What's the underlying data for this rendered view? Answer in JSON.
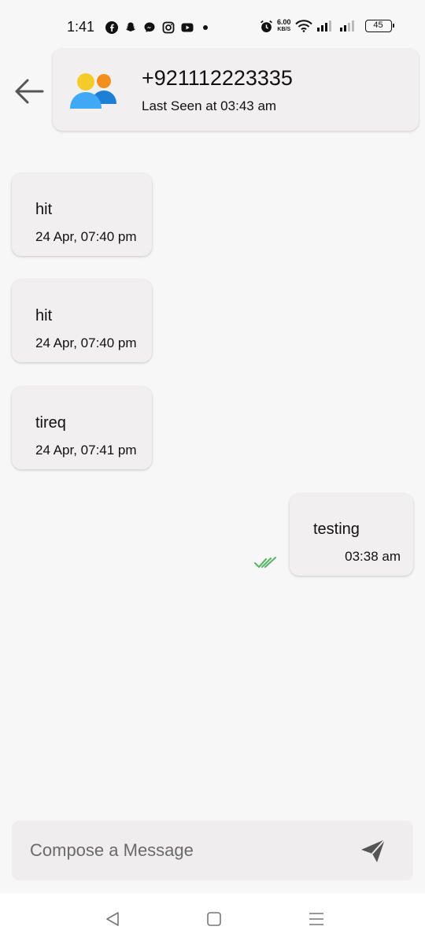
{
  "status_bar": {
    "time": "1:41",
    "net_speed_value": "6.00",
    "net_speed_unit": "KB/S",
    "battery": "45",
    "icons": [
      "facebook-icon",
      "snapchat-icon",
      "messenger-icon",
      "instagram-icon",
      "youtube-icon",
      "notification-dot",
      "alarm-icon",
      "wifi-icon",
      "signal-icon",
      "signal-icon",
      "battery-icon"
    ]
  },
  "header": {
    "contact_name": "+921112223335",
    "last_seen": "Last Seen at 03:43 am",
    "avatar_icon": "contacts-group-icon",
    "back_icon": "arrow-left-icon"
  },
  "messages": [
    {
      "direction": "incoming",
      "text": "hit",
      "time": "24 Apr, 07:40 pm"
    },
    {
      "direction": "incoming",
      "text": "hit",
      "time": "24 Apr, 07:40 pm"
    },
    {
      "direction": "incoming",
      "text": "tireq",
      "time": "24 Apr, 07:41 pm"
    },
    {
      "direction": "outgoing",
      "text": "testing",
      "time": "03:38 am",
      "status_icon": "double-check-icon"
    }
  ],
  "composer": {
    "placeholder": "Compose a Message",
    "value": "",
    "send_icon": "send-icon"
  },
  "colors": {
    "background": "#f7f7f7",
    "bubble": "#f1eff0",
    "read_receipt": "#5fb56d",
    "avatar_yellow": "#f5cb2a",
    "avatar_orange": "#f28f1e",
    "avatar_blue_light": "#3fa9f5",
    "avatar_blue_dark": "#1e7fd6"
  }
}
